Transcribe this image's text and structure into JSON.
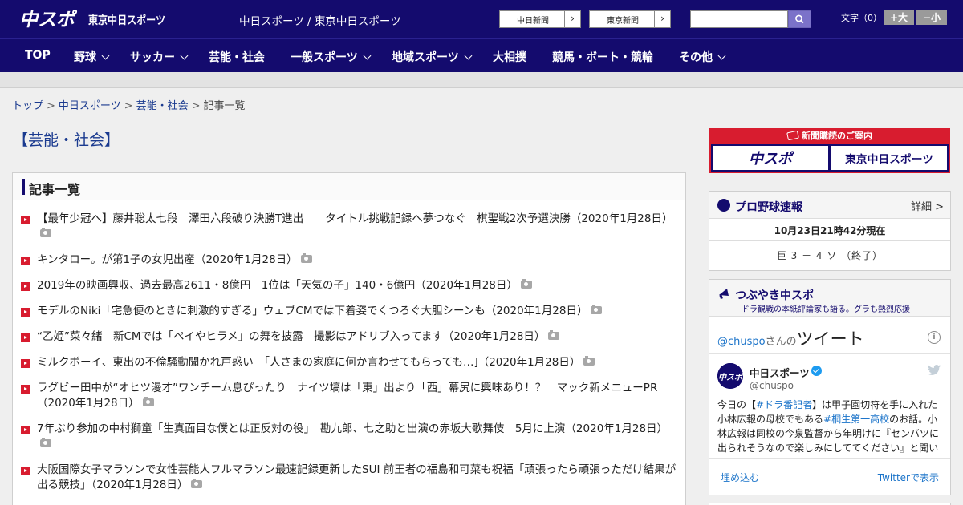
{
  "header": {
    "logo_text": "中スポ",
    "logo2_text": "東京中日スポーツ",
    "site_title": "中日スポーツ / 東京中日スポーツ",
    "links": [
      {
        "label": "中日新聞"
      },
      {
        "label": "東京新聞"
      }
    ],
    "search": {
      "placeholder": ""
    },
    "font_size": {
      "label": "文字（0）",
      "plus": "+大",
      "minus": "−小"
    }
  },
  "nav": {
    "items": [
      {
        "label": "TOP",
        "has_dropdown": false
      },
      {
        "label": "野球",
        "has_dropdown": true
      },
      {
        "label": "サッカー",
        "has_dropdown": true
      },
      {
        "label": "芸能・社会",
        "has_dropdown": false
      },
      {
        "label": "一般スポーツ",
        "has_dropdown": true
      },
      {
        "label": "地域スポーツ",
        "has_dropdown": true
      },
      {
        "label": "大相撲",
        "has_dropdown": false
      },
      {
        "label": "競馬・ボート・競輪",
        "has_dropdown": false
      },
      {
        "label": "その他",
        "has_dropdown": true
      }
    ]
  },
  "breadcrumb": {
    "items": [
      "トップ",
      "中日スポーツ",
      "芸能・社会"
    ],
    "separator": ">",
    "current": "記事一覧"
  },
  "page": {
    "title": "【芸能・社会】",
    "list_heading": "記事一覧"
  },
  "articles": [
    {
      "text": "【最年少冠へ】藤井聡太七段　澤田六段破り決勝T進出　　タイトル挑戦記録へ夢つなぐ　棋聖戦2次予選決勝（2020年1月28日）",
      "has_photo": true
    },
    {
      "text": "キンタロー。が第1子の女児出産（2020年1月28日）",
      "has_photo": true
    },
    {
      "text": "2019年の映画興収、過去最高2611・8億円　1位は「天気の子」140・6億円（2020年1月28日）",
      "has_photo": true
    },
    {
      "text": "モデルのNiki「宅急便のときに刺激的すぎる」ウェブCMでは下着姿でくつろぐ大胆シーンも（2020年1月28日）",
      "has_photo": true
    },
    {
      "text": "“乙姫”菜々緒　新CMでは「ペイやヒラメ」の舞を披露　撮影はアドリブ入ってます（2020年1月28日）",
      "has_photo": true
    },
    {
      "text": "ミルクボーイ、東出の不倫騒動聞かれ戸惑い　「人さまの家庭に何か言わせてもらっても…]（2020年1月28日）",
      "has_photo": true
    },
    {
      "text": "ラグビー田中が“オヒツ漫才”ワンチーム息ぴったり　ナイツ塙は「東」出より「西」幕尻に興味あり！？　マック新メニューPR（2020年1月28日）",
      "has_photo": true
    },
    {
      "text": "7年ぶり参加の中村獅童「生真面目な僕とは正反対の役」　勘九郎、七之助と出演の赤坂大歌舞伎　5月に上演（2020年1月28日）",
      "has_photo": true
    },
    {
      "text": "大阪国際女子マラソンで女性芸能人フルマラソン最速記録更新したSUI 前王者の福島和可菜も祝福「頑張ったら頑張っただけ結果が出る競技」（2020年1月28日）",
      "has_photo": true
    }
  ],
  "sidebar": {
    "subscription": {
      "heading": "新聞購読のご案内",
      "logos": [
        "中スポ",
        "東京中日スポーツ"
      ]
    },
    "baseball": {
      "title": "プロ野球速報",
      "detail_link": "詳細 >",
      "timestamp": "10月23日21時42分現在",
      "score": "巨 3 － 4 ソ （終了）"
    },
    "tweets": {
      "title": "つぶやき中スポ",
      "subtitle": "ドラ観戦の本紙評論家も語る。グラも熱烈応援",
      "user_link": "@chuspo",
      "user_suffix": "さんの",
      "heading": "ツイート",
      "info_icon": "i",
      "author_name": "中日スポーツ",
      "author_handle": "@chuspo",
      "body_prefix": "今日の【",
      "tag1": "#ドラ番記者",
      "body_mid1": "】は甲子園切符を手に入れた小林広報の母校でもある",
      "tag2": "#桐生第一高校",
      "body_rest": "のお話。小林広報は同校の今泉監督から年明けに『センバツに出られそうなので楽しみにしててください』と聞い",
      "embed_label": "埋め込む",
      "view_label": "Twitterで表示"
    }
  },
  "colors": {
    "brand_navy": "#140b6e",
    "accent_red": "#d81c2f",
    "link_blue": "#1a3a8f"
  }
}
